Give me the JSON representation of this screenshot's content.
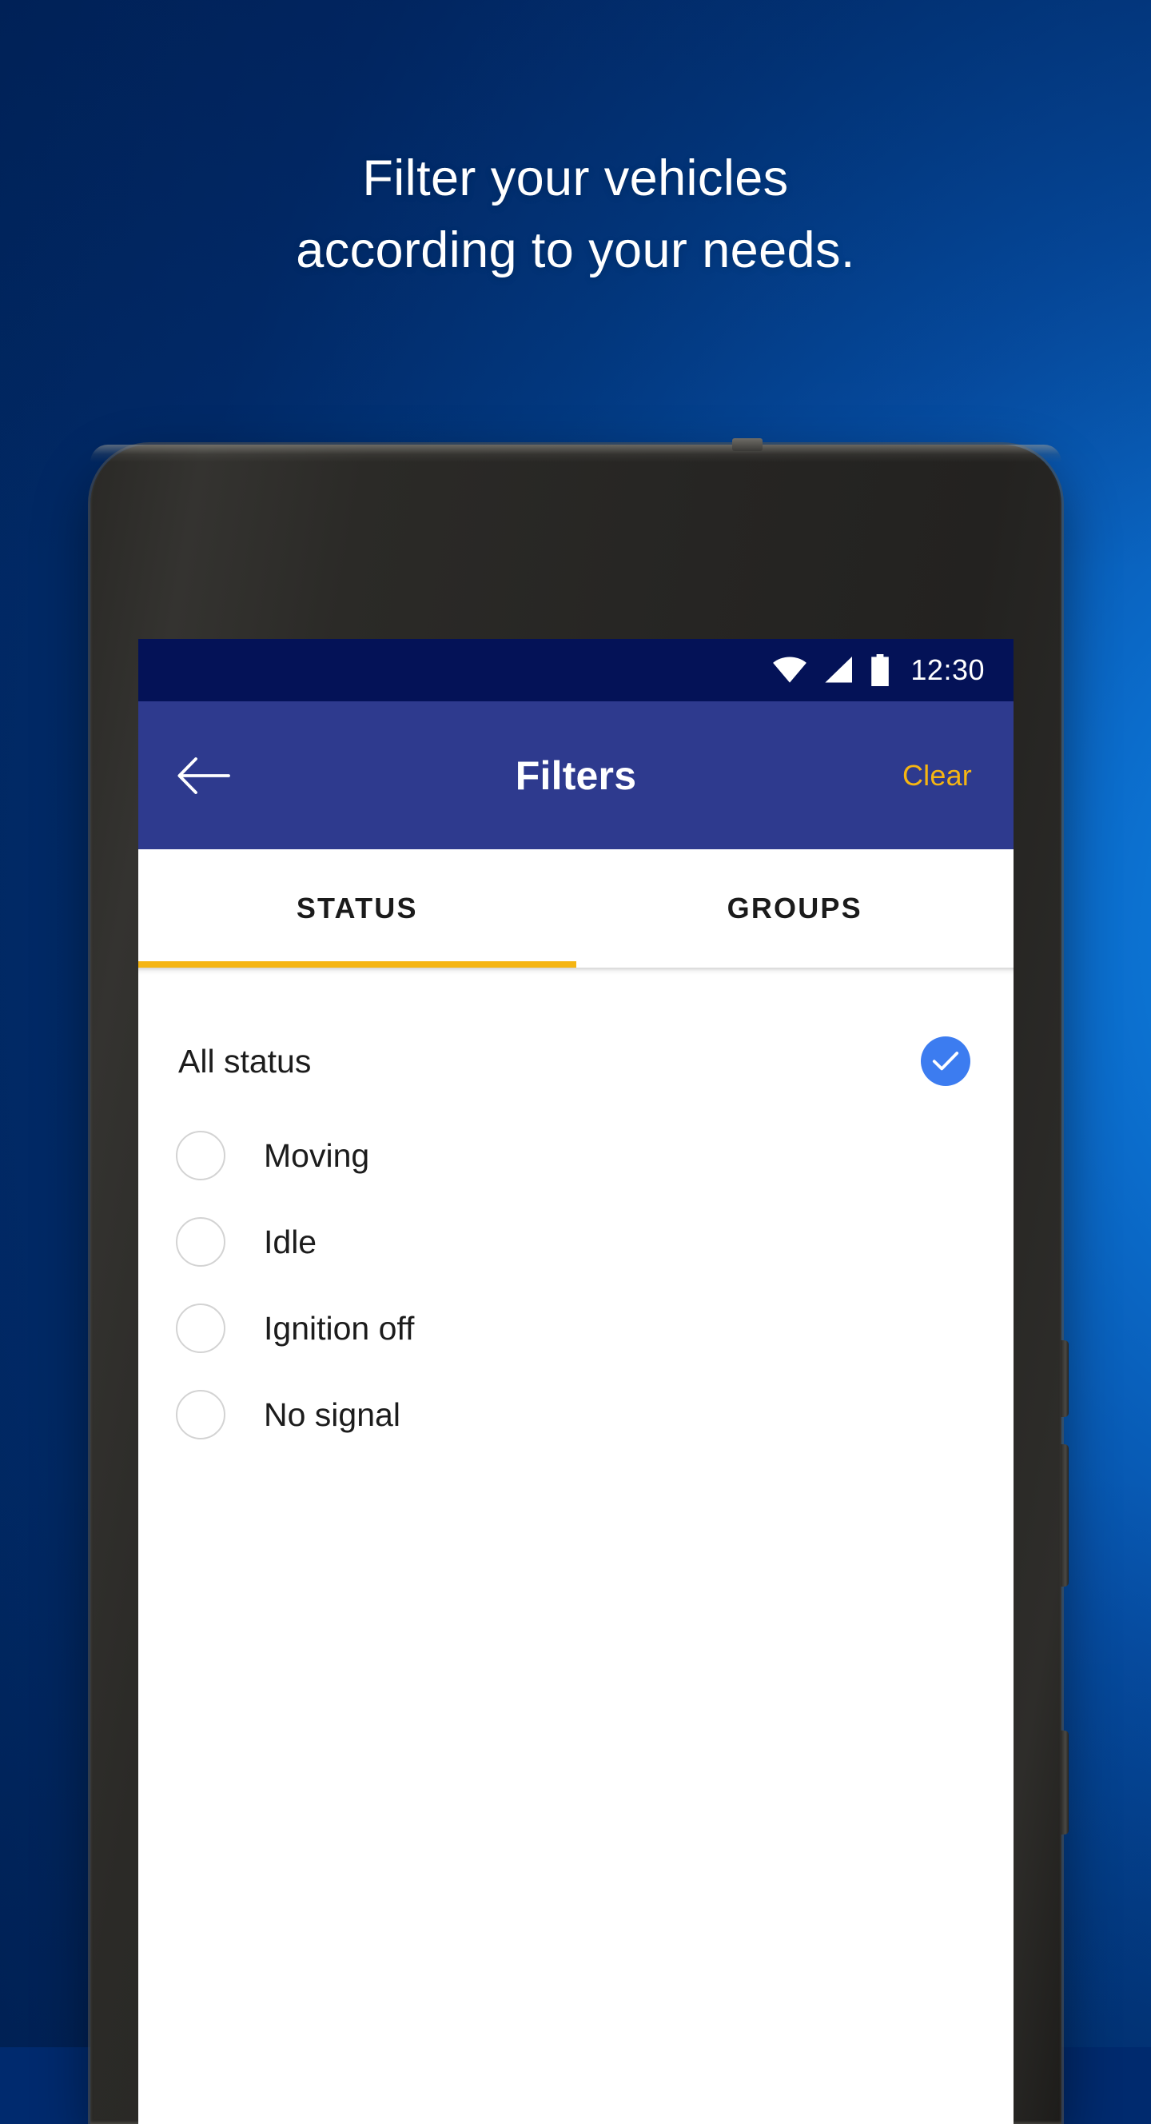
{
  "promo": {
    "headline_line1": "Filter your vehicles",
    "headline_line2": "according to your needs.",
    "background_top_color": "#002a6e",
    "background_accent_color": "#0f86e6",
    "text_color": "#ffffff"
  },
  "device": {
    "bezel_color": "#262523",
    "front_camera_icon": "camera-icon",
    "earpiece_icon": "speaker-grille-icon",
    "sensor_icon": "proximity-sensor-icon"
  },
  "status_bar": {
    "background_color": "#041257",
    "wifi_icon": "wifi-icon",
    "signal_icon": "cell-signal-icon",
    "battery_icon": "battery-full-icon",
    "time": "12:30"
  },
  "app_bar": {
    "background_color": "#2e3a8e",
    "back_icon": "arrow-left-icon",
    "title": "Filters",
    "clear_label": "Clear",
    "clear_color": "#f5b513"
  },
  "tabs": {
    "active_index": 0,
    "indicator_color": "#f5b513",
    "items": [
      {
        "label": "STATUS"
      },
      {
        "label": "GROUPS"
      }
    ]
  },
  "filter_list": {
    "all_status": {
      "label": "All status",
      "selected": true,
      "check_icon": "check-icon",
      "check_color": "#3c7cf0"
    },
    "options": [
      {
        "label": "Moving",
        "selected": false,
        "icon": "radio-unchecked-icon"
      },
      {
        "label": "Idle",
        "selected": false,
        "icon": "radio-unchecked-icon"
      },
      {
        "label": "Ignition off",
        "selected": false,
        "icon": "radio-unchecked-icon"
      },
      {
        "label": "No signal",
        "selected": false,
        "icon": "radio-unchecked-icon"
      }
    ]
  }
}
